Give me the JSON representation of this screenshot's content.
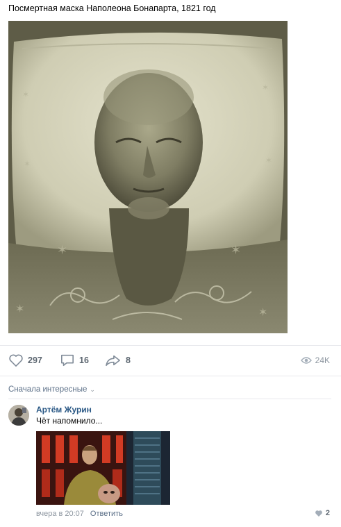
{
  "post": {
    "text": "Посмертная маска Наполеона Бонапарта, 1821 год"
  },
  "actions": {
    "likes": "297",
    "comments": "16",
    "shares": "8",
    "views": "24K"
  },
  "comments_section": {
    "sort_label": "Сначала интересные",
    "comment": {
      "author": "Артём Журин",
      "text": "Чёт напомнило...",
      "time": "вчера в 20:07",
      "reply_label": "Ответить",
      "likes": "2"
    }
  },
  "colors": {
    "link": "#2a5885",
    "secondary": "#8d96a0",
    "divider": "#e7e8ec"
  }
}
